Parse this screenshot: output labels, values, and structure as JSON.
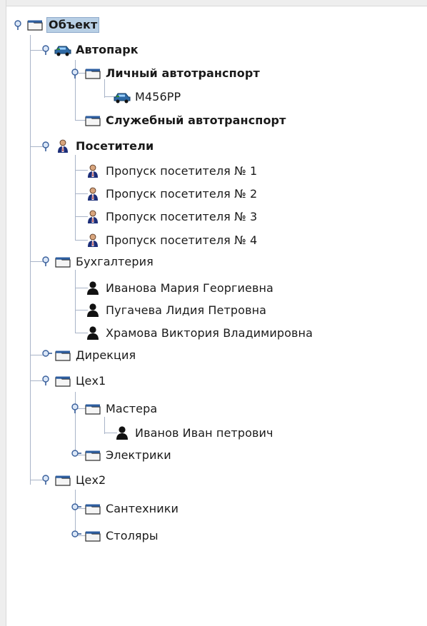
{
  "tree": {
    "nodes": [
      {
        "label": "Объект",
        "icon": "folder-icon"
      },
      {
        "label": "Автопарк",
        "icon": "car-icon"
      },
      {
        "label": "Личный автотранспорт",
        "icon": "folder-icon"
      },
      {
        "label": "М456РР",
        "icon": "car-icon"
      },
      {
        "label": "Служебный автотранспорт",
        "icon": "folder-icon"
      },
      {
        "label": "Посетители",
        "icon": "visitor-icon"
      },
      {
        "label": "Пропуск посетителя № 1",
        "icon": "visitor-icon"
      },
      {
        "label": "Пропуск посетителя № 2",
        "icon": "visitor-icon"
      },
      {
        "label": "Пропуск посетителя № 3",
        "icon": "visitor-icon"
      },
      {
        "label": "Пропуск посетителя № 4",
        "icon": "visitor-icon"
      },
      {
        "label": "Бухгалтерия",
        "icon": "folder-icon"
      },
      {
        "label": "Иванова Мария Георгиевна",
        "icon": "person-icon"
      },
      {
        "label": "Пугачева Лидия Петровна",
        "icon": "person-icon"
      },
      {
        "label": "Храмова Виктория Владимировна",
        "icon": "person-icon"
      },
      {
        "label": "Дирекция",
        "icon": "folder-icon"
      },
      {
        "label": "Цех1",
        "icon": "folder-icon"
      },
      {
        "label": "Мастера",
        "icon": "folder-icon"
      },
      {
        "label": "Иванов Иван петрович",
        "icon": "person-icon"
      },
      {
        "label": "Электрики",
        "icon": "folder-icon"
      },
      {
        "label": "Цех2",
        "icon": "folder-icon"
      },
      {
        "label": "Сантехники",
        "icon": "folder-icon"
      },
      {
        "label": "Столяры",
        "icon": "folder-icon"
      }
    ]
  },
  "colors": {
    "selection_bg": "#b8cfe5",
    "tree_lines": "#a9b4c8",
    "folder_fill": "#f5f5f5",
    "folder_outline": "#303030",
    "person_fill": "#111111",
    "visitor_suit": "#1b2d78",
    "visitor_head": "#d8a57d",
    "car_fill": "#2f6aa5",
    "accent_green": "#2f8b2f"
  }
}
